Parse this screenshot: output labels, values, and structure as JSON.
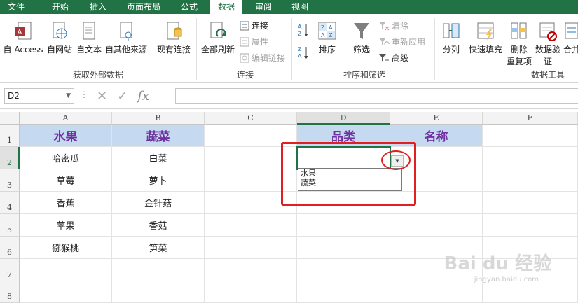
{
  "tabs": [
    "文件",
    "开始",
    "插入",
    "页面布局",
    "公式",
    "数据",
    "审阅",
    "视图"
  ],
  "active_tab": "数据",
  "ribbon": {
    "external": {
      "label": "获取外部数据",
      "access": "自 Access",
      "web": "自网站",
      "text": "自文本",
      "other": "自其他来源",
      "existing": "现有连接"
    },
    "connections": {
      "label": "连接",
      "refresh_all": "全部刷新",
      "connections": "连接",
      "properties": "属性",
      "edit_links": "编辑链接"
    },
    "sort_filter": {
      "label": "排序和筛选",
      "sort": "排序",
      "filter": "筛选",
      "clear": "清除",
      "reapply": "重新应用",
      "advanced": "高级"
    },
    "data_tools": {
      "label": "数据工具",
      "text_to_columns": "分列",
      "flash_fill": "快速填充",
      "remove_duplicates_1": "删除",
      "remove_duplicates_2": "重复项",
      "data_validation_1": "数据验",
      "data_validation_2": "证",
      "consolidate": "合并"
    }
  },
  "formula_bar": {
    "name_box": "D2",
    "fx": "fx",
    "value": ""
  },
  "columns": [
    "A",
    "B",
    "C",
    "D",
    "E",
    "F"
  ],
  "rows": [
    "1",
    "2",
    "3",
    "4",
    "5",
    "6",
    "7",
    "8"
  ],
  "sheet": {
    "A1": "水果",
    "B1": "蔬菜",
    "A2": "哈密瓜",
    "B2": "白菜",
    "A3": "草莓",
    "B3": "萝卜",
    "A4": "香蕉",
    "B4": "金针菇",
    "A5": "苹果",
    "B5": "香菇",
    "A6": "猕猴桃",
    "B6": "笋菜",
    "D1": "品类",
    "E1": "名称"
  },
  "dropdown_options": [
    "水果",
    "蔬菜"
  ],
  "watermark": "Bai du 经验",
  "watermark_url": "jingyan.baidu.com",
  "colors": {
    "accent": "#217346",
    "header_fill": "#c5d9f1",
    "header_text": "#7030a0",
    "highlight": "#e02020"
  }
}
